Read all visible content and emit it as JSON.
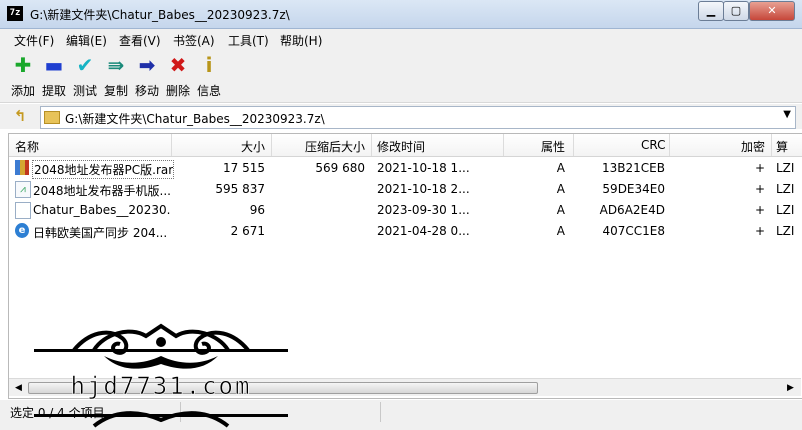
{
  "window": {
    "app_icon_text": "7z",
    "title": "G:\\新建文件夹\\Chatur_Babes__20230923.7z\\",
    "minimize_glyph": "▁",
    "maximize_glyph": "▢",
    "close_glyph": "✕"
  },
  "menu": [
    "文件(F)",
    "编辑(E)",
    "查看(V)",
    "书签(A)",
    "工具(T)",
    "帮助(H)"
  ],
  "toolbar": [
    {
      "label": "添加",
      "icon": "plus-icon",
      "glyph": "✚",
      "color": "#1aa82c"
    },
    {
      "label": "提取",
      "icon": "minus-icon",
      "glyph": "▬",
      "color": "#1f3fd0"
    },
    {
      "label": "测试",
      "icon": "checkmark-icon",
      "glyph": "✔",
      "color": "#17b3c4"
    },
    {
      "label": "复制",
      "icon": "copy-arrow-icon",
      "glyph": "⇛",
      "color": "#1a8a7a"
    },
    {
      "label": "移动",
      "icon": "move-arrow-icon",
      "glyph": "➡",
      "color": "#1f2fa8"
    },
    {
      "label": "删除",
      "icon": "delete-x-icon",
      "glyph": "✖",
      "color": "#d01818"
    },
    {
      "label": "信息",
      "icon": "info-icon",
      "glyph": "i",
      "color": "#b8951a"
    }
  ],
  "address": {
    "up_glyph": "↰",
    "path": "G:\\新建文件夹\\Chatur_Babes__20230923.7z\\",
    "dropdown_glyph": "▼"
  },
  "columns": [
    "名称",
    "大小",
    "压缩后大小",
    "修改时间",
    "属性",
    "CRC",
    "加密",
    "算"
  ],
  "rows": [
    {
      "name": "2048地址发布器PC版.rar",
      "size": "17 515",
      "packed": "569 680",
      "modified": "2021-10-18 1...",
      "attr": "A",
      "crc": "13B21CEB",
      "enc": "+",
      "method": "LZI",
      "icon": "rar-archive-icon",
      "icon_glyph": "",
      "icon_class": "ic-rar"
    },
    {
      "name": "2048地址发布器手机版....",
      "size": "595 837",
      "packed": "",
      "modified": "2021-10-18 2...",
      "attr": "A",
      "crc": "59DE34E0",
      "enc": "+",
      "method": "LZI",
      "icon": "apk-file-icon",
      "icon_glyph": "⩘",
      "icon_class": "ic-apk"
    },
    {
      "name": "Chatur_Babes__20230...",
      "size": "96",
      "packed": "",
      "modified": "2023-09-30 1...",
      "attr": "A",
      "crc": "AD6A2E4D",
      "enc": "+",
      "method": "LZI",
      "icon": "text-file-icon",
      "icon_glyph": "",
      "icon_class": "ic-txt"
    },
    {
      "name": "日韩欧美国产同步 204...",
      "size": "2 671",
      "packed": "",
      "modified": "2021-04-28 0...",
      "attr": "A",
      "crc": "407CC1E8",
      "enc": "+",
      "method": "LZI",
      "icon": "internet-shortcut-icon",
      "icon_glyph": "e",
      "icon_class": "ic-url"
    }
  ],
  "scroll": {
    "left_glyph": "◀",
    "right_glyph": "▶"
  },
  "status": {
    "text": "选定 0 / 4 个项目"
  },
  "watermark": {
    "text": "hjd7731.com"
  }
}
